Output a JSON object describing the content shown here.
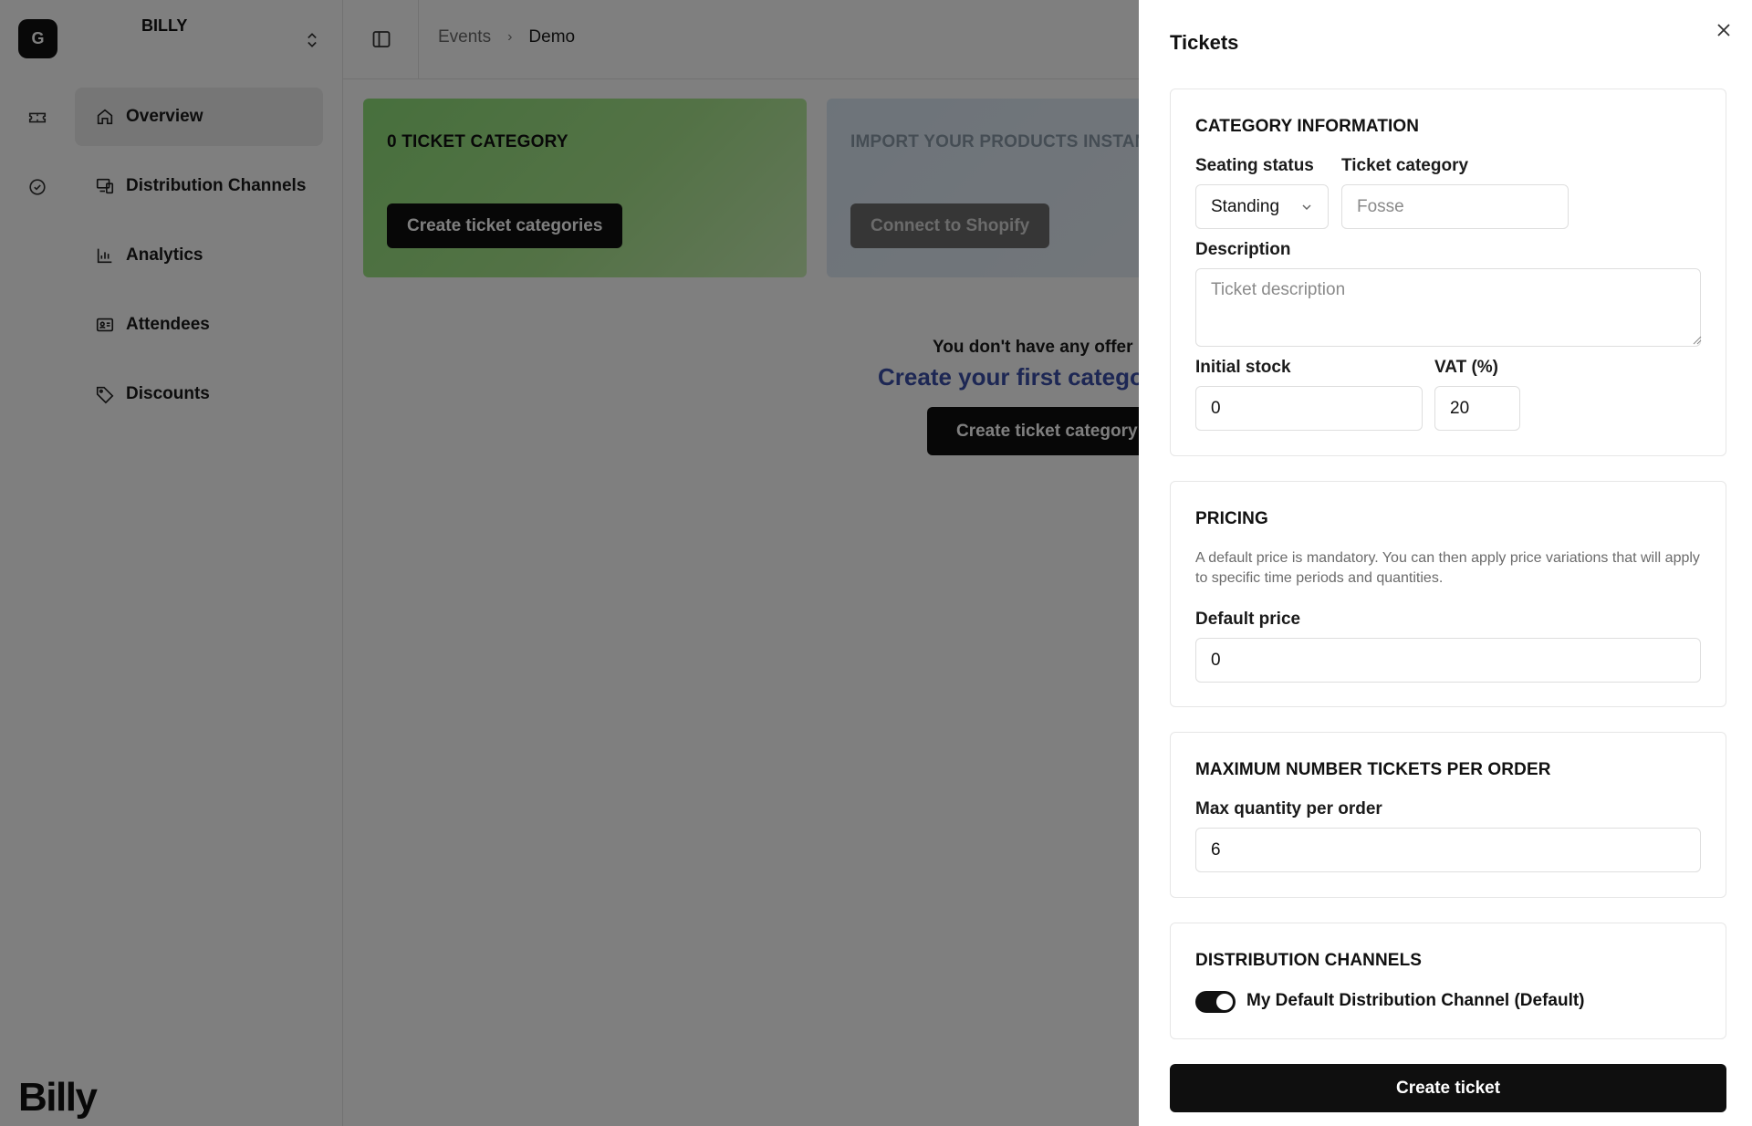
{
  "workspace": {
    "initial": "G",
    "name": "BILLY"
  },
  "nav": [
    {
      "label": "Overview",
      "icon": "home-icon"
    },
    {
      "label": "Distribution Channels",
      "icon": "devices-icon"
    },
    {
      "label": "Analytics",
      "icon": "bar-chart-icon"
    },
    {
      "label": "Attendees",
      "icon": "id-card-icon"
    },
    {
      "label": "Discounts",
      "icon": "tag-icon"
    }
  ],
  "brand": "Billy",
  "breadcrumb": {
    "parent": "Events",
    "current": "Demo"
  },
  "cards": {
    "tickets": {
      "title": "0 TICKET CATEGORY",
      "button": "Create ticket categories"
    },
    "shopify": {
      "title": "IMPORT YOUR PRODUCTS INSTAN",
      "button": "Connect to Shopify"
    }
  },
  "empty_state": {
    "text": "You don't have any offer",
    "link": "Create your first categor",
    "button": "Create ticket category"
  },
  "drawer": {
    "title": "Tickets",
    "category": {
      "heading": "CATEGORY INFORMATION",
      "seating_label": "Seating status",
      "seating_value": "Standing",
      "ticket_category_label": "Ticket category",
      "ticket_category_placeholder": "Fosse",
      "description_label": "Description",
      "description_placeholder": "Ticket description",
      "stock_label": "Initial stock",
      "stock_value": "0",
      "vat_label": "VAT (%)",
      "vat_value": "20"
    },
    "pricing": {
      "heading": "PRICING",
      "help": "A default price is mandatory. You can then apply price variations that will apply to specific time periods and quantities.",
      "default_price_label": "Default price",
      "default_price_value": "0"
    },
    "max_tickets": {
      "heading": "MAXIMUM NUMBER TICKETS PER ORDER",
      "label": "Max quantity per order",
      "value": "6"
    },
    "distribution": {
      "heading": "DISTRIBUTION CHANNELS",
      "channel_label": "My Default Distribution Channel (Default)",
      "enabled": true
    },
    "submit": "Create ticket"
  }
}
